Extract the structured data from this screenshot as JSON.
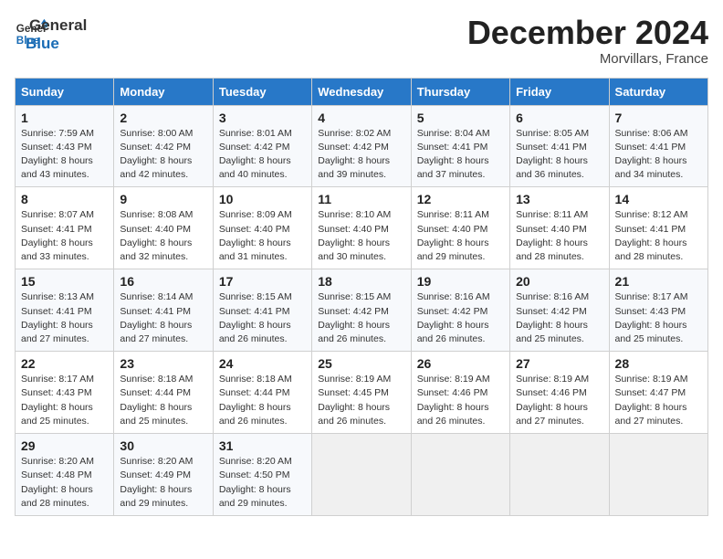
{
  "header": {
    "logo_line1": "General",
    "logo_line2": "Blue",
    "title": "December 2024",
    "location": "Morvillars, France"
  },
  "columns": [
    "Sunday",
    "Monday",
    "Tuesday",
    "Wednesday",
    "Thursday",
    "Friday",
    "Saturday"
  ],
  "weeks": [
    [
      {
        "day": "1",
        "sunrise": "Sunrise: 7:59 AM",
        "sunset": "Sunset: 4:43 PM",
        "daylight": "Daylight: 8 hours and 43 minutes."
      },
      {
        "day": "2",
        "sunrise": "Sunrise: 8:00 AM",
        "sunset": "Sunset: 4:42 PM",
        "daylight": "Daylight: 8 hours and 42 minutes."
      },
      {
        "day": "3",
        "sunrise": "Sunrise: 8:01 AM",
        "sunset": "Sunset: 4:42 PM",
        "daylight": "Daylight: 8 hours and 40 minutes."
      },
      {
        "day": "4",
        "sunrise": "Sunrise: 8:02 AM",
        "sunset": "Sunset: 4:42 PM",
        "daylight": "Daylight: 8 hours and 39 minutes."
      },
      {
        "day": "5",
        "sunrise": "Sunrise: 8:04 AM",
        "sunset": "Sunset: 4:41 PM",
        "daylight": "Daylight: 8 hours and 37 minutes."
      },
      {
        "day": "6",
        "sunrise": "Sunrise: 8:05 AM",
        "sunset": "Sunset: 4:41 PM",
        "daylight": "Daylight: 8 hours and 36 minutes."
      },
      {
        "day": "7",
        "sunrise": "Sunrise: 8:06 AM",
        "sunset": "Sunset: 4:41 PM",
        "daylight": "Daylight: 8 hours and 34 minutes."
      }
    ],
    [
      {
        "day": "8",
        "sunrise": "Sunrise: 8:07 AM",
        "sunset": "Sunset: 4:41 PM",
        "daylight": "Daylight: 8 hours and 33 minutes."
      },
      {
        "day": "9",
        "sunrise": "Sunrise: 8:08 AM",
        "sunset": "Sunset: 4:40 PM",
        "daylight": "Daylight: 8 hours and 32 minutes."
      },
      {
        "day": "10",
        "sunrise": "Sunrise: 8:09 AM",
        "sunset": "Sunset: 4:40 PM",
        "daylight": "Daylight: 8 hours and 31 minutes."
      },
      {
        "day": "11",
        "sunrise": "Sunrise: 8:10 AM",
        "sunset": "Sunset: 4:40 PM",
        "daylight": "Daylight: 8 hours and 30 minutes."
      },
      {
        "day": "12",
        "sunrise": "Sunrise: 8:11 AM",
        "sunset": "Sunset: 4:40 PM",
        "daylight": "Daylight: 8 hours and 29 minutes."
      },
      {
        "day": "13",
        "sunrise": "Sunrise: 8:11 AM",
        "sunset": "Sunset: 4:40 PM",
        "daylight": "Daylight: 8 hours and 28 minutes."
      },
      {
        "day": "14",
        "sunrise": "Sunrise: 8:12 AM",
        "sunset": "Sunset: 4:41 PM",
        "daylight": "Daylight: 8 hours and 28 minutes."
      }
    ],
    [
      {
        "day": "15",
        "sunrise": "Sunrise: 8:13 AM",
        "sunset": "Sunset: 4:41 PM",
        "daylight": "Daylight: 8 hours and 27 minutes."
      },
      {
        "day": "16",
        "sunrise": "Sunrise: 8:14 AM",
        "sunset": "Sunset: 4:41 PM",
        "daylight": "Daylight: 8 hours and 27 minutes."
      },
      {
        "day": "17",
        "sunrise": "Sunrise: 8:15 AM",
        "sunset": "Sunset: 4:41 PM",
        "daylight": "Daylight: 8 hours and 26 minutes."
      },
      {
        "day": "18",
        "sunrise": "Sunrise: 8:15 AM",
        "sunset": "Sunset: 4:42 PM",
        "daylight": "Daylight: 8 hours and 26 minutes."
      },
      {
        "day": "19",
        "sunrise": "Sunrise: 8:16 AM",
        "sunset": "Sunset: 4:42 PM",
        "daylight": "Daylight: 8 hours and 26 minutes."
      },
      {
        "day": "20",
        "sunrise": "Sunrise: 8:16 AM",
        "sunset": "Sunset: 4:42 PM",
        "daylight": "Daylight: 8 hours and 25 minutes."
      },
      {
        "day": "21",
        "sunrise": "Sunrise: 8:17 AM",
        "sunset": "Sunset: 4:43 PM",
        "daylight": "Daylight: 8 hours and 25 minutes."
      }
    ],
    [
      {
        "day": "22",
        "sunrise": "Sunrise: 8:17 AM",
        "sunset": "Sunset: 4:43 PM",
        "daylight": "Daylight: 8 hours and 25 minutes."
      },
      {
        "day": "23",
        "sunrise": "Sunrise: 8:18 AM",
        "sunset": "Sunset: 4:44 PM",
        "daylight": "Daylight: 8 hours and 25 minutes."
      },
      {
        "day": "24",
        "sunrise": "Sunrise: 8:18 AM",
        "sunset": "Sunset: 4:44 PM",
        "daylight": "Daylight: 8 hours and 26 minutes."
      },
      {
        "day": "25",
        "sunrise": "Sunrise: 8:19 AM",
        "sunset": "Sunset: 4:45 PM",
        "daylight": "Daylight: 8 hours and 26 minutes."
      },
      {
        "day": "26",
        "sunrise": "Sunrise: 8:19 AM",
        "sunset": "Sunset: 4:46 PM",
        "daylight": "Daylight: 8 hours and 26 minutes."
      },
      {
        "day": "27",
        "sunrise": "Sunrise: 8:19 AM",
        "sunset": "Sunset: 4:46 PM",
        "daylight": "Daylight: 8 hours and 27 minutes."
      },
      {
        "day": "28",
        "sunrise": "Sunrise: 8:19 AM",
        "sunset": "Sunset: 4:47 PM",
        "daylight": "Daylight: 8 hours and 27 minutes."
      }
    ],
    [
      {
        "day": "29",
        "sunrise": "Sunrise: 8:20 AM",
        "sunset": "Sunset: 4:48 PM",
        "daylight": "Daylight: 8 hours and 28 minutes."
      },
      {
        "day": "30",
        "sunrise": "Sunrise: 8:20 AM",
        "sunset": "Sunset: 4:49 PM",
        "daylight": "Daylight: 8 hours and 29 minutes."
      },
      {
        "day": "31",
        "sunrise": "Sunrise: 8:20 AM",
        "sunset": "Sunset: 4:50 PM",
        "daylight": "Daylight: 8 hours and 29 minutes."
      },
      null,
      null,
      null,
      null
    ]
  ]
}
